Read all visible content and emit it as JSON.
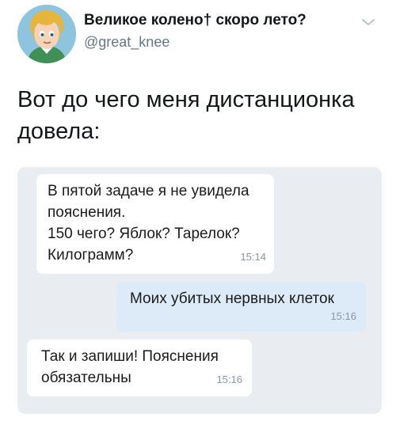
{
  "author": {
    "display_name": "Великое колено† скоро лето?",
    "handle": "@great_knee"
  },
  "tweet": {
    "text": "Вот до чего меня дистанционка довела:"
  },
  "icons": {
    "avatar": "cartoon-boy-avatar",
    "menu": "chevron-down-icon"
  },
  "chat": {
    "messages": [
      {
        "direction": "incoming",
        "lines": [
          "В пятой задаче я не увидела",
          "пояснения.",
          "150 чего? Яблок? Тарелок?",
          "Килограмм?"
        ],
        "time": "15:14"
      },
      {
        "direction": "outgoing",
        "lines": [
          "Моих убитых нервных клеток"
        ],
        "time": "15:16"
      },
      {
        "direction": "incoming",
        "lines": [
          "Так и запиши! Пояснения",
          "обязательны"
        ],
        "time": "15:16"
      }
    ]
  },
  "colors": {
    "chat_background": "#e9edf2",
    "incoming_bubble": "#ffffff",
    "outgoing_bubble": "#dcebf7",
    "handle_gray": "#657786"
  }
}
